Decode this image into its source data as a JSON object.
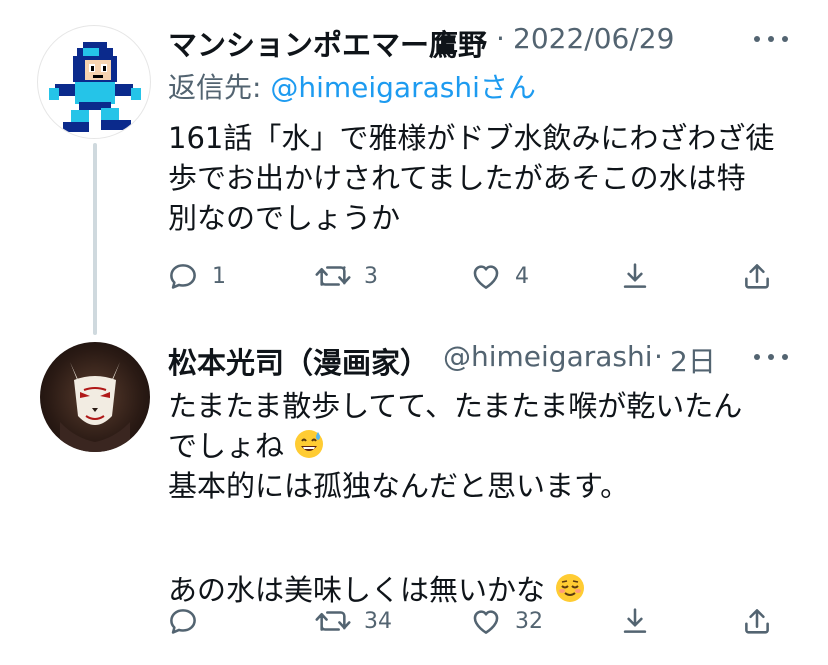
{
  "tweets": [
    {
      "author": "マンションポエマー鷹野",
      "date": "2022/06/29",
      "reply_label": "返信先:",
      "reply_handle": "@himeigarashi",
      "reply_suffix": "さん",
      "text_lines": [
        "161話「水」で雅様がドブ水飲みにわざわざ徒",
        "歩でお出かけされてましたがあそこの水は特",
        "別なのでしょうか"
      ],
      "stats": {
        "replies": "1",
        "retweets": "3",
        "likes": "4"
      }
    },
    {
      "author": "松本光司（漫画家）",
      "handle": "@himeigarashi",
      "date": "2日",
      "text_lines": [
        "たまたま散歩してて、たまたま喉が乾いたん",
        "でしょね",
        "基本的には孤独なんだと思います。",
        "",
        "あの水は美味しくは無いかな"
      ],
      "stats": {
        "replies": "",
        "retweets": "34",
        "likes": "32"
      }
    }
  ],
  "colors": {
    "text": "#0f1419",
    "secondary": "#536471",
    "link": "#1d9bf0",
    "thread_line": "#cfd9de"
  },
  "icons": [
    "reply-icon",
    "retweet-icon",
    "like-icon",
    "share-icon",
    "upload-icon",
    "more-icon",
    "sweat-smile-emoji",
    "relieved-emoji"
  ]
}
